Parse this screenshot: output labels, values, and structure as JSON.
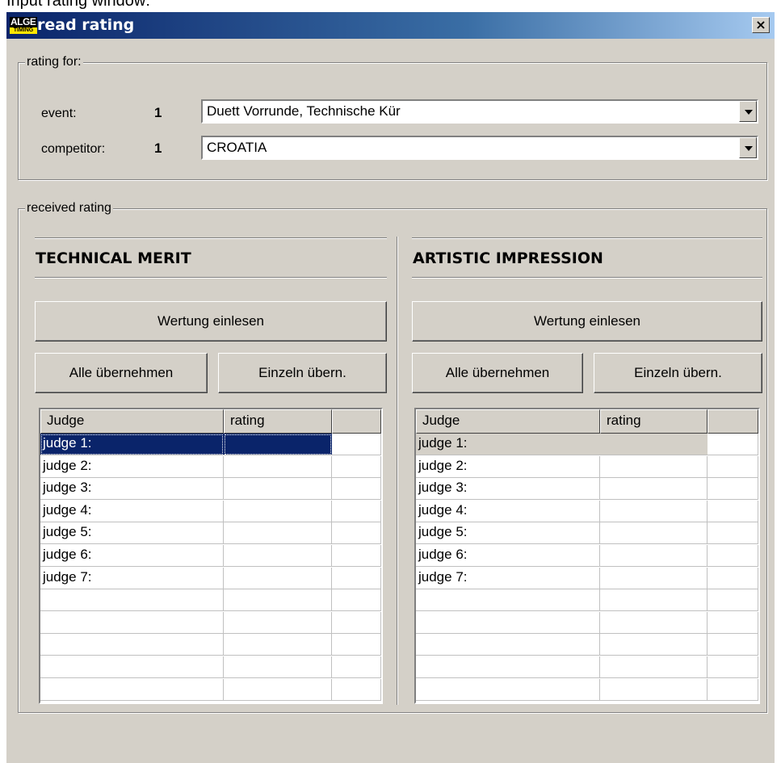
{
  "caption": "Input rating window:",
  "window": {
    "title": "read rating",
    "logo_top": "ALGE",
    "logo_bottom": "TIMING",
    "close_symbol": "×"
  },
  "rating_for": {
    "legend": "rating for:",
    "event_label": "event:",
    "event_num": "1",
    "event_value": "Duett Vorrunde, Technische Kür",
    "competitor_label": "competitor:",
    "competitor_num": "1",
    "competitor_value": "CROATIA"
  },
  "received": {
    "legend": "received rating",
    "panels": [
      {
        "title": "TECHNICAL MERIT",
        "read_button": "Wertung einlesen",
        "all_button": "Alle übernehmen",
        "single_button": "Einzeln übern.",
        "columns": [
          "Judge",
          "rating",
          ""
        ],
        "rows": [
          "judge 1:",
          "judge 2:",
          "judge 3:",
          "judge 4:",
          "judge 5:",
          "judge 6:",
          "judge 7:"
        ],
        "selected_row": 0
      },
      {
        "title": "ARTISTIC IMPRESSION",
        "read_button": "Wertung einlesen",
        "all_button": "Alle übernehmen",
        "single_button": "Einzeln übern.",
        "columns": [
          "Judge",
          "rating",
          ""
        ],
        "rows": [
          "judge 1:",
          "judge 2:",
          "judge 3:",
          "judge 4:",
          "judge 5:",
          "judge 6:",
          "judge 7:"
        ],
        "selected_row": 0
      }
    ]
  },
  "colors": {
    "title_gradient_start": "#0a246a",
    "title_gradient_end": "#a6caf0",
    "dialog_bg": "#d4d0c8",
    "selection": "#0a246a"
  }
}
